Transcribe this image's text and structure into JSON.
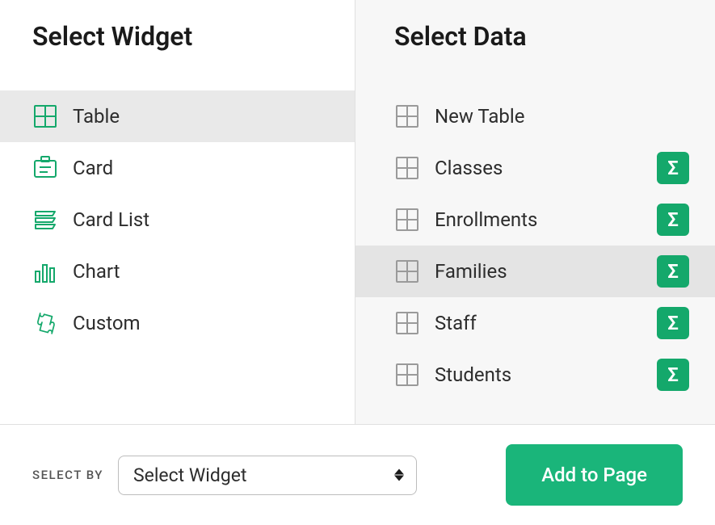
{
  "left": {
    "title": "Select Widget",
    "items": [
      {
        "label": "Table",
        "icon": "table",
        "selected": true
      },
      {
        "label": "Card",
        "icon": "card",
        "selected": false
      },
      {
        "label": "Card List",
        "icon": "cardlist",
        "selected": false
      },
      {
        "label": "Chart",
        "icon": "chart",
        "selected": false
      },
      {
        "label": "Custom",
        "icon": "custom",
        "selected": false
      }
    ]
  },
  "right": {
    "title": "Select Data",
    "items": [
      {
        "label": "New Table",
        "has_sigma": false,
        "hovered": false
      },
      {
        "label": "Classes",
        "has_sigma": true,
        "hovered": false
      },
      {
        "label": "Enrollments",
        "has_sigma": true,
        "hovered": false
      },
      {
        "label": "Families",
        "has_sigma": true,
        "hovered": true
      },
      {
        "label": "Staff",
        "has_sigma": true,
        "hovered": false
      },
      {
        "label": "Students",
        "has_sigma": true,
        "hovered": false
      }
    ]
  },
  "footer": {
    "label": "SELECT BY",
    "select_value": "Select Widget",
    "button_label": "Add to Page"
  },
  "sigma_glyph": "Σ",
  "colors": {
    "accent": "#14a86b",
    "button": "#1ab57a"
  }
}
